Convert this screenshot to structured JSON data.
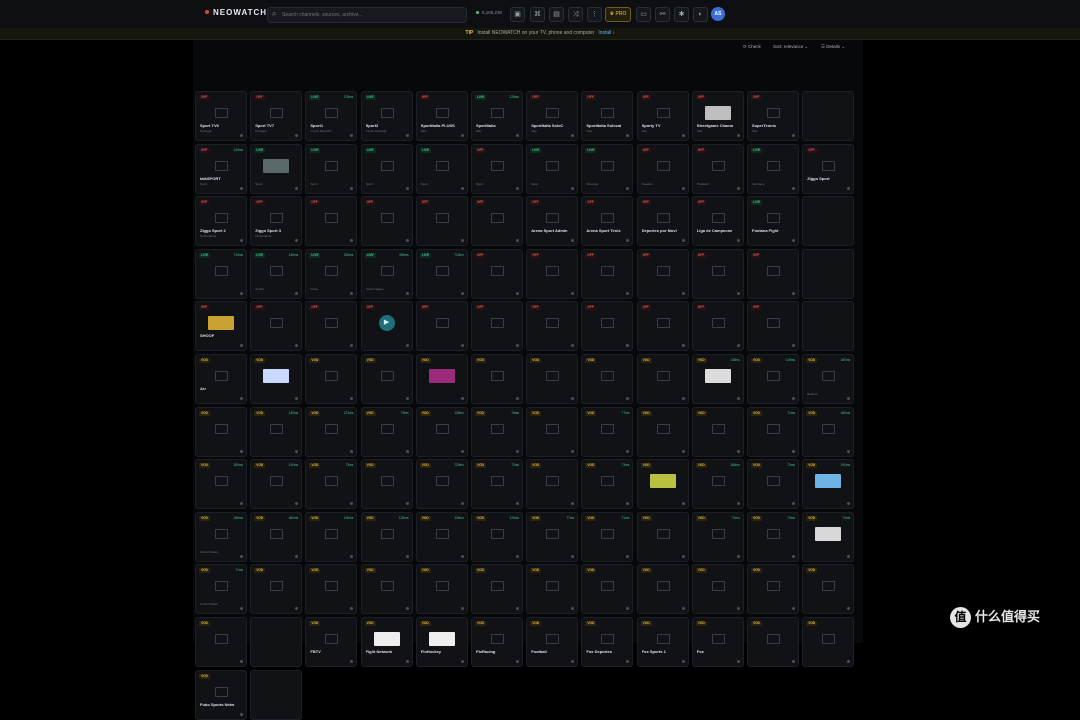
{
  "header": {
    "logo": "NEOWATCH",
    "search_placeholder": "Search channels, sources, archive...",
    "status": "8,186,236",
    "pro_label": "♛ PRO",
    "avatar": "AS"
  },
  "banner": {
    "tip": "TIP",
    "text": "Install NEOWATCH on your TV, phone and computer",
    "install": "Install ›"
  },
  "sortbar": {
    "check": "Check",
    "sort": "Sort: relevance",
    "view": "Grid",
    "details": "Details"
  },
  "colors": {
    "offline": "#d9574f",
    "live": "#3ec98a",
    "vod": "#e0b94a",
    "accent": "#5ab3ff"
  },
  "cards": [
    {
      "badge": "OFF",
      "name": "Sport TV6",
      "meta": "Portugal"
    },
    {
      "badge": "OFF",
      "name": "Sport TV7",
      "meta": "Portugal"
    },
    {
      "badge": "LIVE",
      "name": "Sport1",
      "meta": "Czech Republic",
      "ping": "125ms"
    },
    {
      "badge": "LIVE",
      "name": "Sport2",
      "meta": "Czech Republic"
    },
    {
      "badge": "OFF",
      "name": "SportItalia PLUSS",
      "meta": "Italy"
    },
    {
      "badge": "LIVE",
      "name": "SportItalia",
      "meta": "Italy",
      "ping": "128ms"
    },
    {
      "badge": "OFF",
      "name": "SportItalia SoloC",
      "meta": "Italy"
    },
    {
      "badge": "OFF",
      "name": "SportItalia Solocal",
      "meta": "Italy"
    },
    {
      "badge": "OFF",
      "name": "Sporty TV",
      "meta": "Italy"
    },
    {
      "badge": "OFF",
      "name": "Streetgame Chamo",
      "meta": "Italy"
    },
    {
      "badge": "OFF",
      "name": "SuperTennis",
      "meta": "Italy"
    },
    {
      "badge": "",
      "name": "",
      "meta": ""
    },
    {
      "badge": "OFF",
      "name": "talkSPORT",
      "meta": "Sport",
      "ping": "140ms"
    },
    {
      "badge": "LIVE",
      "name": "",
      "meta": "Sport"
    },
    {
      "badge": "LIVE",
      "name": "",
      "meta": "Sport"
    },
    {
      "badge": "LIVE",
      "name": "",
      "meta": "Sport"
    },
    {
      "badge": "LIVE",
      "name": "",
      "meta": "Sport"
    },
    {
      "badge": "OFF",
      "name": "",
      "meta": "Sport"
    },
    {
      "badge": "LIVE",
      "name": "",
      "meta": "Sport"
    },
    {
      "badge": "LIVE",
      "name": "",
      "meta": "Slovenia"
    },
    {
      "badge": "OFF",
      "name": "",
      "meta": "Sweden"
    },
    {
      "badge": "OFF",
      "name": "",
      "meta": "Thailand"
    },
    {
      "badge": "LIVE",
      "name": "",
      "meta": "Germany"
    },
    {
      "badge": "OFF",
      "name": "Ziggo Sport",
      "meta": ""
    },
    {
      "badge": "OFF",
      "name": "Ziggo Sport 2",
      "meta": "Netherlands"
    },
    {
      "badge": "OFF",
      "name": "Ziggo Sport 3",
      "meta": "Netherlands"
    },
    {
      "badge": "OFF",
      "name": "",
      "meta": ""
    },
    {
      "badge": "OFF",
      "name": "",
      "meta": ""
    },
    {
      "badge": "OFF",
      "name": "",
      "meta": ""
    },
    {
      "badge": "OFF",
      "name": "",
      "meta": ""
    },
    {
      "badge": "OFF",
      "name": "Arena Sport Admin",
      "meta": ""
    },
    {
      "badge": "OFF",
      "name": "Arena Sport Tenis",
      "meta": ""
    },
    {
      "badge": "OFF",
      "name": "Deportes por Movi",
      "meta": ""
    },
    {
      "badge": "OFF",
      "name": "Liga de Campeone",
      "meta": ""
    },
    {
      "badge": "LIVE",
      "name": "Fontana Fight",
      "meta": ""
    },
    {
      "badge": "",
      "name": "",
      "meta": ""
    },
    {
      "badge": "LIVE",
      "name": "",
      "meta": "",
      "ping": "710ms"
    },
    {
      "badge": "LIVE",
      "name": "",
      "meta": "Serbia",
      "ping": "145ms"
    },
    {
      "badge": "LIVE",
      "name": "",
      "meta": "Cuba",
      "ping": "300ms"
    },
    {
      "badge": "LIVE",
      "name": "",
      "meta": "United States",
      "ping": "495ms"
    },
    {
      "badge": "LIVE",
      "name": "",
      "meta": "",
      "ping": "710ms"
    },
    {
      "badge": "OFF",
      "name": "",
      "meta": ""
    },
    {
      "badge": "OFF",
      "name": "",
      "meta": ""
    },
    {
      "badge": "OFF",
      "name": "",
      "meta": ""
    },
    {
      "badge": "OFF",
      "name": "",
      "meta": ""
    },
    {
      "badge": "OFF",
      "name": "",
      "meta": ""
    },
    {
      "badge": "OFF",
      "name": "",
      "meta": ""
    },
    {
      "badge": "",
      "name": "",
      "meta": ""
    },
    {
      "badge": "OFF",
      "name": "SHOOF",
      "meta": ""
    },
    {
      "badge": "OFF",
      "name": "",
      "meta": ""
    },
    {
      "badge": "OFF",
      "name": "",
      "meta": ""
    },
    {
      "badge": "OFF",
      "name": "",
      "meta": ""
    },
    {
      "badge": "OFF",
      "name": "",
      "meta": ""
    },
    {
      "badge": "OFF",
      "name": "",
      "meta": ""
    },
    {
      "badge": "OFF",
      "name": "",
      "meta": ""
    },
    {
      "badge": "OFF",
      "name": "",
      "meta": ""
    },
    {
      "badge": "OFF",
      "name": "",
      "meta": ""
    },
    {
      "badge": "OFF",
      "name": "",
      "meta": ""
    },
    {
      "badge": "OFF",
      "name": "",
      "meta": ""
    },
    {
      "badge": "",
      "name": "",
      "meta": ""
    },
    {
      "badge": "VOD",
      "name": "Arr",
      "meta": ""
    },
    {
      "badge": "VOD",
      "name": "",
      "meta": ""
    },
    {
      "badge": "VOD",
      "name": "",
      "meta": ""
    },
    {
      "badge": "VOD",
      "name": "",
      "meta": ""
    },
    {
      "badge": "VOD",
      "name": "",
      "meta": ""
    },
    {
      "badge": "VOD",
      "name": "",
      "meta": ""
    },
    {
      "badge": "VOD",
      "name": "",
      "meta": ""
    },
    {
      "badge": "VOD",
      "name": "",
      "meta": ""
    },
    {
      "badge": "VOD",
      "name": "",
      "meta": ""
    },
    {
      "badge": "VOD",
      "name": "",
      "meta": "",
      "ping": "130ms"
    },
    {
      "badge": "VOD",
      "name": "",
      "meta": "",
      "ping": "115ms"
    },
    {
      "badge": "VOD",
      "name": "",
      "meta": "Belarus",
      "ping": "180ms"
    },
    {
      "badge": "VOD",
      "name": "",
      "meta": ""
    },
    {
      "badge": "VOD",
      "name": "",
      "meta": "",
      "ping": "130ms"
    },
    {
      "badge": "VOD",
      "name": "",
      "meta": "",
      "ping": "271ms"
    },
    {
      "badge": "VOD",
      "name": "",
      "meta": "",
      "ping": "75ms"
    },
    {
      "badge": "VOD",
      "name": "",
      "meta": "",
      "ping": "125ms"
    },
    {
      "badge": "VOD",
      "name": "",
      "meta": "",
      "ping": "76ms"
    },
    {
      "badge": "VOD",
      "name": "",
      "meta": ""
    },
    {
      "badge": "VOD",
      "name": "",
      "meta": "",
      "ping": "77ms"
    },
    {
      "badge": "VOD",
      "name": "",
      "meta": ""
    },
    {
      "badge": "VOD",
      "name": "",
      "meta": ""
    },
    {
      "badge": "VOD",
      "name": "",
      "meta": "",
      "ping": "71ms"
    },
    {
      "badge": "VOD",
      "name": "",
      "meta": "",
      "ping": "180ms"
    },
    {
      "badge": "VOD",
      "name": "",
      "meta": "",
      "ping": "180ms"
    },
    {
      "badge": "VOD",
      "name": "",
      "meta": "",
      "ping": "140ms"
    },
    {
      "badge": "VOD",
      "name": "",
      "meta": "",
      "ping": "73ms"
    },
    {
      "badge": "VOD",
      "name": "",
      "meta": ""
    },
    {
      "badge": "VOD",
      "name": "",
      "meta": "",
      "ping": "720ms"
    },
    {
      "badge": "VOD",
      "name": "",
      "meta": "",
      "ping": "72ms"
    },
    {
      "badge": "VOD",
      "name": "",
      "meta": ""
    },
    {
      "badge": "VOD",
      "name": "",
      "meta": "",
      "ping": "73ms"
    },
    {
      "badge": "VOD",
      "name": "",
      "meta": ""
    },
    {
      "badge": "VOD",
      "name": "",
      "meta": "",
      "ping": "180ms"
    },
    {
      "badge": "VOD",
      "name": "",
      "meta": "",
      "ping": "73ms"
    },
    {
      "badge": "VOD",
      "name": "",
      "meta": "",
      "ping": "190ms"
    },
    {
      "badge": "VOD",
      "name": "",
      "meta": "United States",
      "ping": "180ms"
    },
    {
      "badge": "VOD",
      "name": "",
      "meta": "",
      "ping": "180ms"
    },
    {
      "badge": "VOD",
      "name": "",
      "meta": "",
      "ping": "190ms"
    },
    {
      "badge": "VOD",
      "name": "",
      "meta": "",
      "ping": "125ms"
    },
    {
      "badge": "VOD",
      "name": "",
      "meta": "",
      "ping": "125ms"
    },
    {
      "badge": "VOD",
      "name": "",
      "meta": "",
      "ping": "125ms"
    },
    {
      "badge": "VOD",
      "name": "",
      "meta": "",
      "ping": "77ms"
    },
    {
      "badge": "VOD",
      "name": "",
      "meta": "",
      "ping": "71ms"
    },
    {
      "badge": "VOD",
      "name": "",
      "meta": ""
    },
    {
      "badge": "VOD",
      "name": "",
      "meta": "",
      "ping": "71ms"
    },
    {
      "badge": "VOD",
      "name": "",
      "meta": "",
      "ping": "73ms"
    },
    {
      "badge": "VOD",
      "name": "",
      "meta": "",
      "ping": "73ms"
    },
    {
      "badge": "VOD",
      "name": "",
      "meta": "United States",
      "ping": "71ms"
    },
    {
      "badge": "VOD",
      "name": "",
      "meta": ""
    },
    {
      "badge": "VOD",
      "name": "",
      "meta": ""
    },
    {
      "badge": "VOD",
      "name": "",
      "meta": ""
    },
    {
      "badge": "VOD",
      "name": "",
      "meta": ""
    },
    {
      "badge": "VOD",
      "name": "",
      "meta": ""
    },
    {
      "badge": "VOD",
      "name": "",
      "meta": ""
    },
    {
      "badge": "VOD",
      "name": "",
      "meta": ""
    },
    {
      "badge": "VOD",
      "name": "",
      "meta": ""
    },
    {
      "badge": "VOD",
      "name": "",
      "meta": ""
    },
    {
      "badge": "VOD",
      "name": "",
      "meta": ""
    },
    {
      "badge": "VOD",
      "name": "",
      "meta": ""
    },
    {
      "badge": "VOD",
      "name": "",
      "meta": ""
    },
    {
      "badge": "",
      "name": "",
      "meta": ""
    },
    {
      "badge": "VOD",
      "name": "FBTV",
      "meta": ""
    },
    {
      "badge": "VOD",
      "name": "Fight Network",
      "meta": ""
    },
    {
      "badge": "VOD",
      "name": "FloHockey",
      "meta": ""
    },
    {
      "badge": "VOD",
      "name": "FloRacing",
      "meta": ""
    },
    {
      "badge": "VOD",
      "name": "Football",
      "meta": ""
    },
    {
      "badge": "VOD",
      "name": "Fox Deportes",
      "meta": ""
    },
    {
      "badge": "VOD",
      "name": "Fox Sports 1",
      "meta": ""
    },
    {
      "badge": "VOD",
      "name": "Fox",
      "meta": ""
    },
    {
      "badge": "VOD",
      "name": "",
      "meta": ""
    },
    {
      "badge": "VOD",
      "name": "",
      "meta": ""
    },
    {
      "badge": "VOD",
      "name": "Fubo Sports Netw",
      "meta": ""
    },
    {
      "badge": "",
      "name": "",
      "meta": ""
    }
  ],
  "logos": [
    {
      "card": 9,
      "color": "#bfbfbf"
    },
    {
      "card": 13,
      "color": "#5a6a6a"
    },
    {
      "card": 48,
      "color": "#c9a233"
    },
    {
      "card": 61,
      "color": "#c9d8ff"
    },
    {
      "card": 64,
      "color": "#9b2a7a"
    },
    {
      "card": 69,
      "color": "#dcdcdc"
    },
    {
      "card": 92,
      "color": "#b9c240"
    },
    {
      "card": 95,
      "color": "#6fb3e6"
    },
    {
      "card": 107,
      "color": "#d8d8d8"
    },
    {
      "card": 123,
      "color": "#eeeeee"
    },
    {
      "card": 124,
      "color": "#eeeeee"
    }
  ],
  "player_card": 51,
  "watermark": "什么值得买"
}
